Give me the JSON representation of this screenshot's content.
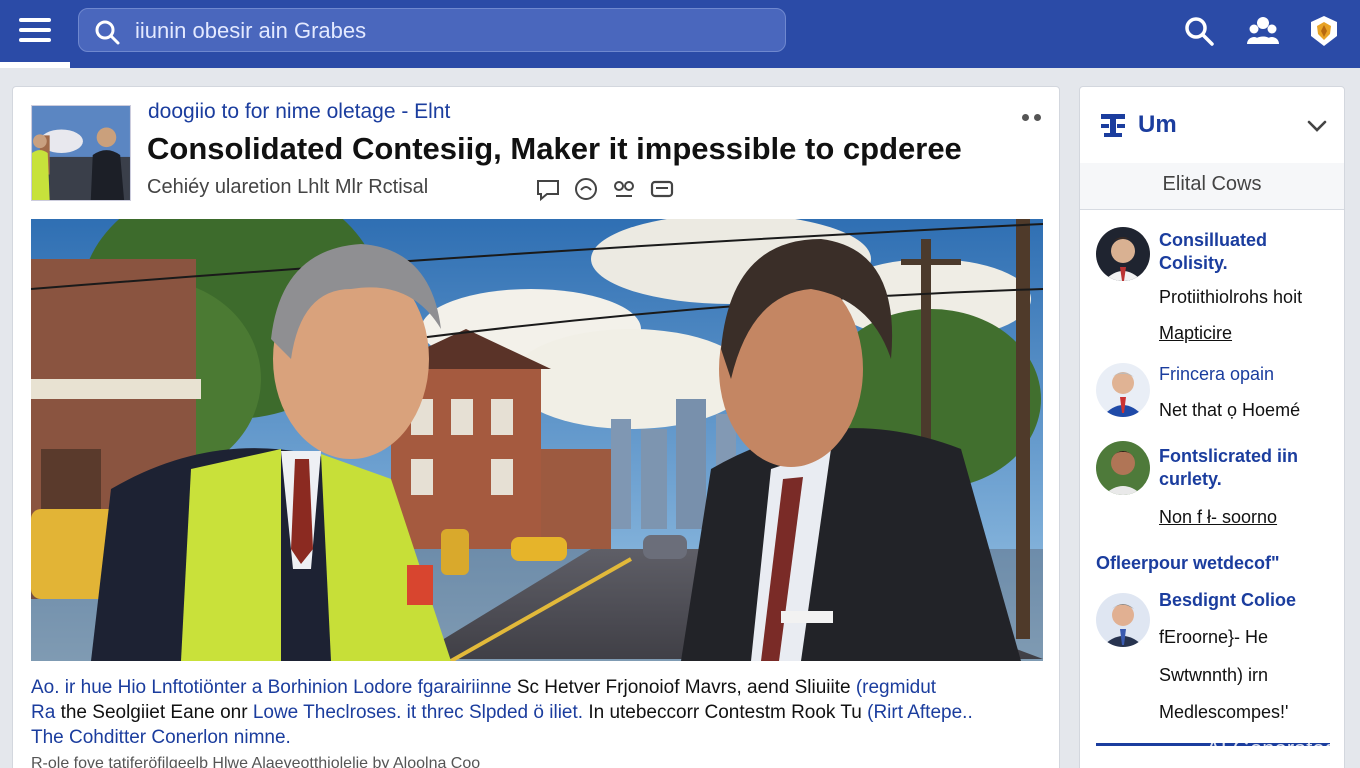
{
  "header": {
    "menu_icon": "hamburger-menu-icon",
    "search_placeholder": "iiunin obesir ain Grabes",
    "icons": [
      "search-icon",
      "people-icon",
      "badge-icon"
    ]
  },
  "article": {
    "kicker": "doogiio to for nime oletage - Elnt",
    "headline": "Consolidated Contesiig, Maker it impessible to cpderee",
    "byline": "Cehiéy ularetion Lhlt Mlr Rctisal",
    "byline_icons": [
      "comment-icon",
      "share-icon",
      "chat-icon",
      "bookmark-icon"
    ],
    "body": {
      "l1_link": "Ao. ir hue Hio Lnftotiönter a Borhinion Lodore fgarairiinne",
      "l1_text": " Sc Hetver Frjonoiof Mavrs, aend Sliuiite ",
      "l1_link2": "(regmidut",
      "l2_link": "Ra",
      "l2_text": " the Seolgiiet Eane onr ",
      "l2_link2": "Lowe Theclroses. it threc Slpded ö iliet.",
      "l2_text2": " In utebeccorr Contestm Rook Tu ",
      "l2_link3": "(Rirt Aftepe..",
      "l3_link": "The Cohditter Conerlon nimne."
    },
    "body_more": "R-ole fove tatiferöfilgeelb Hlwe Alaeveotthiolelie by Aloolna Coo"
  },
  "sidebar": {
    "header_title": "Um",
    "sub_label": "Elital Cows",
    "items": [
      {
        "title_1": "Consilluated",
        "title_2": "Colisity.",
        "line_1": "Protiithiolrohs hoit",
        "line_2": "Mapticire"
      },
      {
        "title_1": "Frincera opain",
        "line_1": "Net that ọ Hoemé"
      },
      {
        "title_1": "Fontslicrated iin",
        "title_2": "curlety.",
        "line_1": "Non f ł- soorno"
      }
    ],
    "section_title": "Ofleerpour wetdecof\"",
    "items2": [
      {
        "title_1": "Besdignt Colioe",
        "line_1": "fEroorne}- He",
        "line_2": "Swtwnnth) irn",
        "line_3": "Medlescompes!'"
      }
    ]
  },
  "watermark": "AI Generated",
  "colors": {
    "topbar": "#2b4ba7",
    "link": "#1b3d9e",
    "background": "#e4e7ec"
  }
}
